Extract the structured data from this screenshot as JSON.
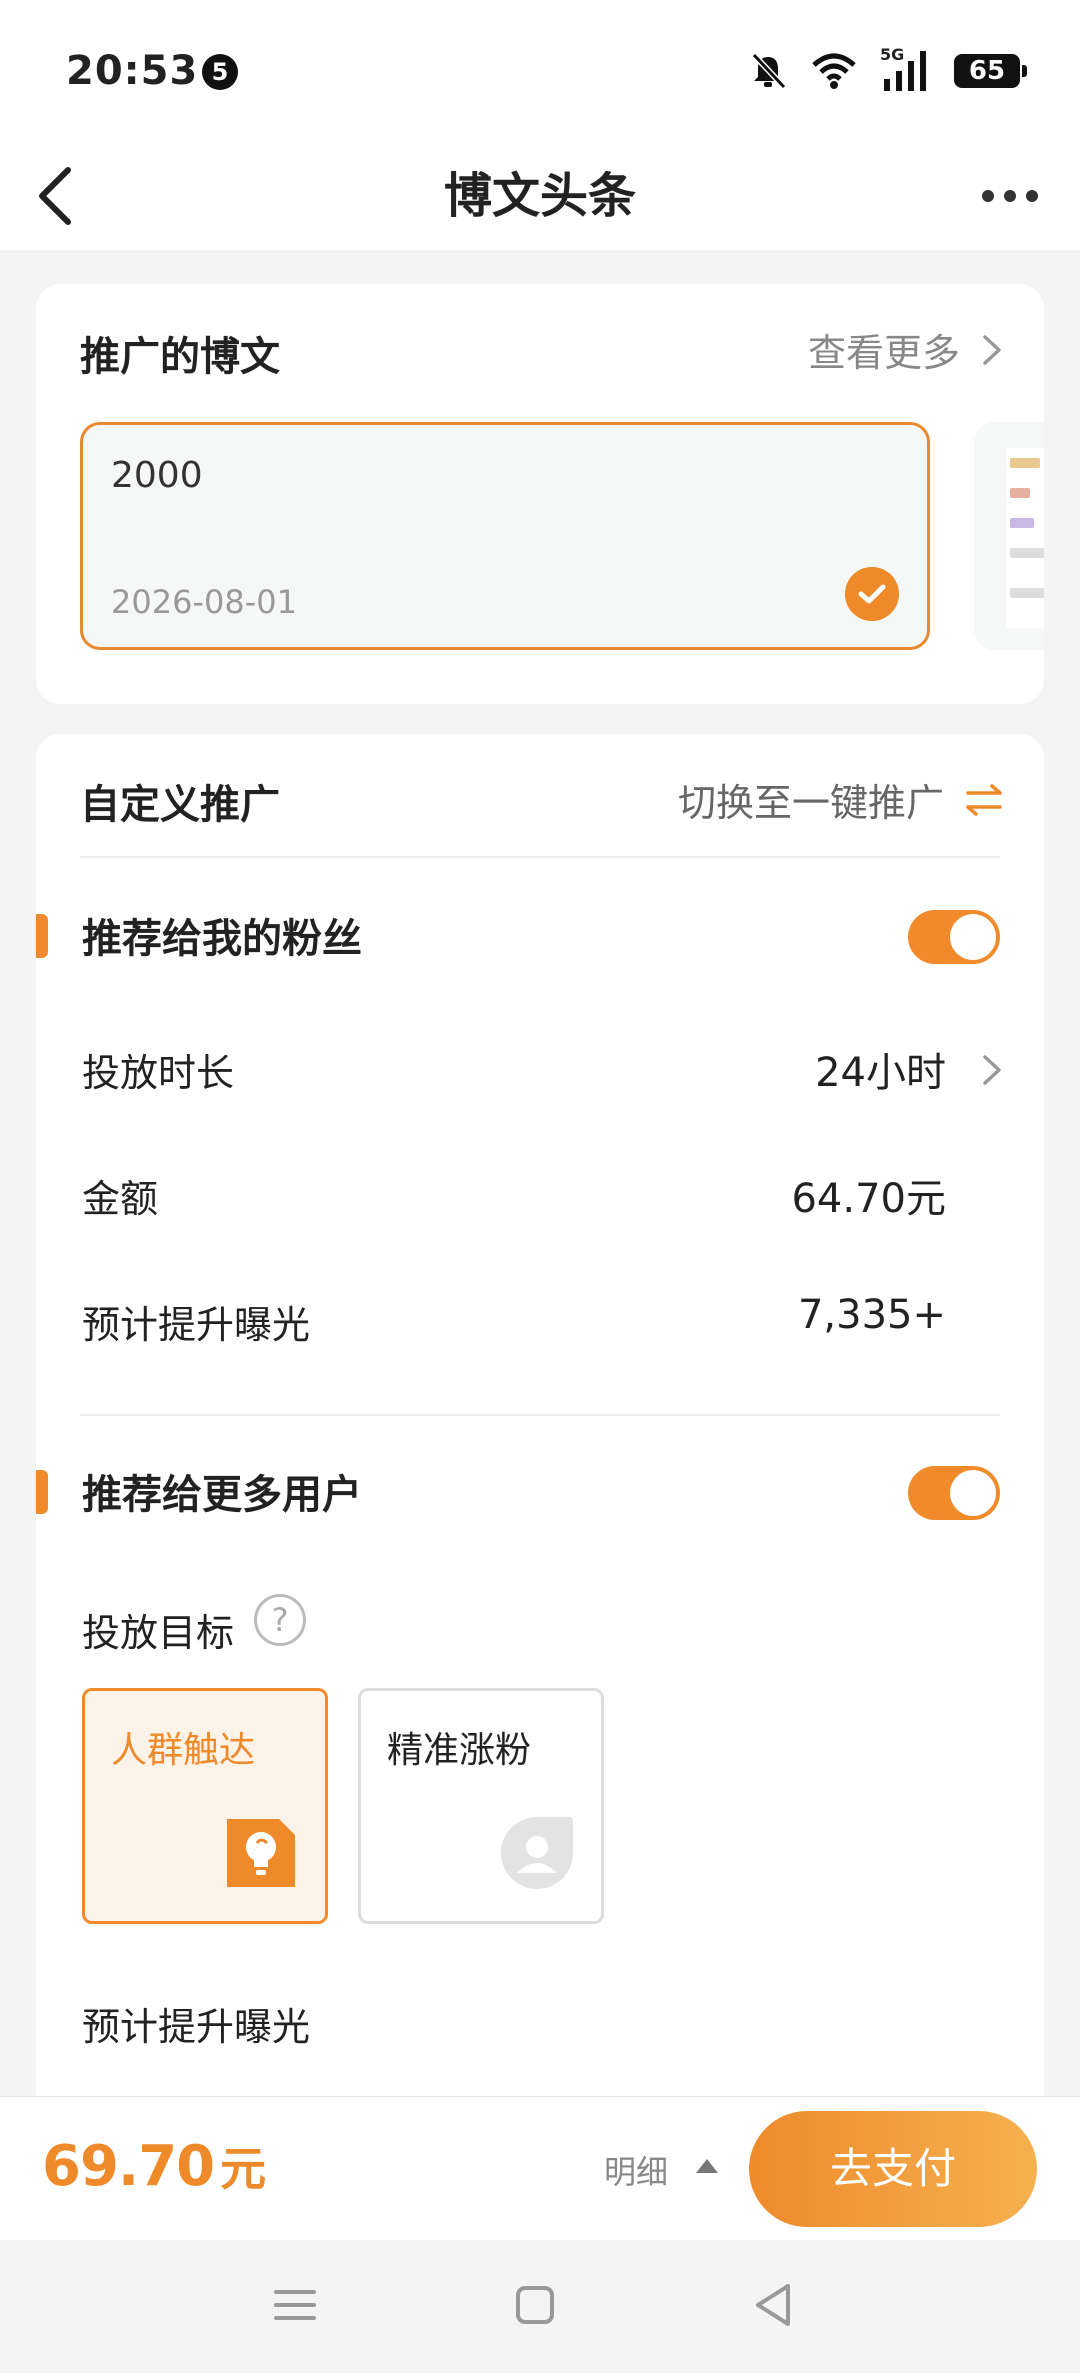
{
  "status_bar": {
    "time": "20:53",
    "notification_count": "5",
    "network": "5G",
    "battery": "65"
  },
  "header": {
    "title": "博文头条"
  },
  "promoted_post": {
    "title": "推广的博文",
    "more_label": "查看更多",
    "selected_post": {
      "title": "2000",
      "date": "2026-08-01"
    }
  },
  "custom_promotion": {
    "title": "自定义推广",
    "switch_label": "切换至一键推广",
    "fans_section": {
      "title": "推荐给我的粉丝",
      "enabled": true,
      "duration_label": "投放时长",
      "duration_value": "24小时",
      "amount_label": "金额",
      "amount_value": "64.70元",
      "exposure_label": "预计提升曝光",
      "exposure_value": "7,335+"
    },
    "more_users_section": {
      "title": "推荐给更多用户",
      "enabled": true,
      "goal_label": "投放目标",
      "help_symbol": "?",
      "goals": [
        {
          "label": "人群触达",
          "selected": true,
          "icon": "lightbulb-icon"
        },
        {
          "label": "精准涨粉",
          "selected": false,
          "icon": "user-icon"
        }
      ],
      "exposure_label": "预计提升曝光"
    }
  },
  "footer": {
    "total": "69.70",
    "unit": "元",
    "detail_label": "明细",
    "pay_label": "去支付"
  },
  "colors": {
    "accent": "#EF8A2A",
    "selected_bg": "#FEF3E8"
  }
}
